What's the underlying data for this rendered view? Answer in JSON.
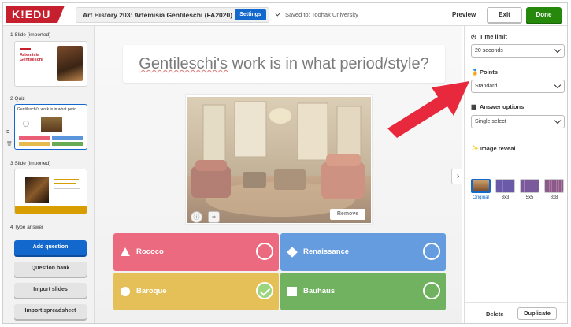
{
  "app": {
    "logo": "K!EDU",
    "title": "Art History 203: Artemisia Gentileschi (FA2020)",
    "settings_label": "Settings",
    "saved_text": "Saved to: Toohak University",
    "preview_label": "Preview",
    "exit_label": "Exit",
    "done_label": "Done",
    "colors": {
      "brand_red": "#c6202f",
      "primary_blue": "#1368ce",
      "done_green": "#26890c"
    }
  },
  "sidebar": {
    "slides": [
      {
        "index_label": "1  Slide (imported)",
        "thumb_title": "Artemisia Gentileschi"
      },
      {
        "index_label": "2  Quiz",
        "thumb_title": "Gentileschi's work is in what perio..."
      },
      {
        "index_label": "3  Slide (imported)",
        "thumb_title": ""
      }
    ],
    "next_label": "4  Type answer",
    "buttons": {
      "add_question": "Add question",
      "question_bank": "Question bank",
      "import_slides": "Import slides",
      "import_spreadsheet": "Import spreadsheet"
    }
  },
  "question": {
    "text_pre": "Gentileschi's",
    "text_post": " work is in what period/style?",
    "image_remove_label": "Remove",
    "answers": [
      {
        "label": "Rococo",
        "shape": "triangle-icon",
        "color": "#e21b3c",
        "correct": false
      },
      {
        "label": "Renaissance",
        "shape": "diamond-icon",
        "color": "#1368ce",
        "correct": false
      },
      {
        "label": "Baroque",
        "shape": "circle-icon",
        "color": "#d89e00",
        "correct": true
      },
      {
        "label": "Bauhaus",
        "shape": "square-icon",
        "color": "#26890c",
        "correct": false
      }
    ]
  },
  "panel": {
    "time_limit": {
      "heading": "Time limit",
      "value": "20 seconds"
    },
    "points": {
      "heading": "Points",
      "value": "Standard"
    },
    "answer_options": {
      "heading": "Answer options",
      "value": "Single select"
    },
    "image_reveal": {
      "heading": "Image reveal",
      "options": [
        "Original",
        "3x3",
        "5x5",
        "8x8"
      ],
      "selected": "Original"
    },
    "delete_label": "Delete",
    "duplicate_label": "Duplicate"
  }
}
